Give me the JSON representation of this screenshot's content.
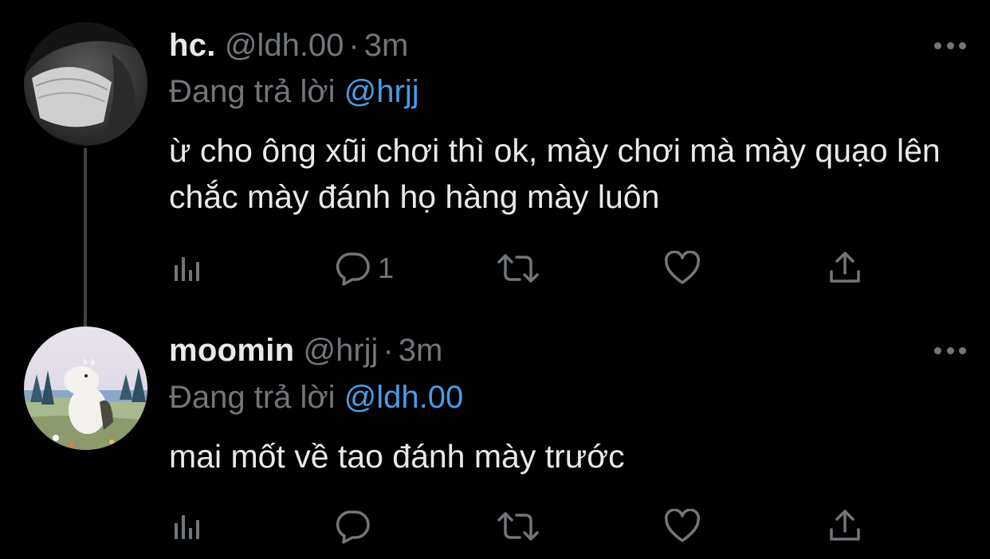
{
  "colors": {
    "background": "#000000",
    "text_primary": "#e7e9ea",
    "text_secondary": "#71767b",
    "mention": "#4b9be8",
    "thread_line": "#3e4144"
  },
  "tweets": [
    {
      "display_name": "hc.",
      "handle": "@ldh.00",
      "separator": "·",
      "time": "3m",
      "reply_prefix": "Đang trả lời",
      "reply_to": "@hrjj",
      "text": "ừ cho ông xũi chơi thì ok, mày chơi mà mày quạo lên chắc mày đánh họ hàng mày luôn",
      "reply_count": "1",
      "icons": [
        "views-icon",
        "reply-icon",
        "retweet-icon",
        "like-icon",
        "share-icon",
        "more-icon"
      ]
    },
    {
      "display_name": "moomin",
      "handle": "@hrjj",
      "separator": "·",
      "time": "3m",
      "reply_prefix": "Đang trả lời",
      "reply_to": "@ldh.00",
      "text": "mai mốt về tao đánh mày trước",
      "reply_count": "",
      "icons": [
        "views-icon",
        "reply-icon",
        "retweet-icon",
        "like-icon",
        "share-icon",
        "more-icon"
      ]
    }
  ]
}
